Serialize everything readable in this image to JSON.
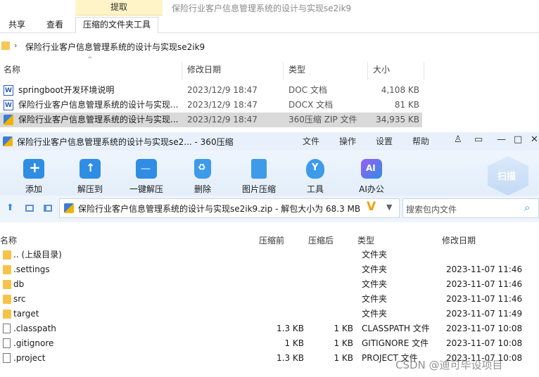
{
  "explorer": {
    "context_tab": "提取",
    "window_title": "保险行业客户信息管理系统的设计与实现se2ik9",
    "ribbon_tabs": [
      "共享",
      "查看",
      "压缩的文件夹工具"
    ],
    "path": "保险行业客户信息管理系统的设计与实现se2ik9",
    "columns": [
      "名称",
      "修改日期",
      "类型",
      "大小"
    ],
    "files": [
      {
        "name": "springboot开发环境说明",
        "date": "2023/12/9 18:47",
        "type": "DOC 文档",
        "size": "4,108 KB",
        "icon": "word-icon"
      },
      {
        "name": "保险行业客户信息管理系统的设计与实现...",
        "date": "2023/12/9 18:47",
        "type": "DOCX 文档",
        "size": "81 KB",
        "icon": "word-icon"
      },
      {
        "name": "保险行业客户信息管理系统的设计与实现...",
        "date": "2023/12/9 18:47",
        "type": "360压缩 ZIP 文件",
        "size": "34,935 KB",
        "icon": "zip-icon",
        "selected": true
      }
    ]
  },
  "zip": {
    "title": "保险行业客户信息管理系统的设计与实现se2... - 360压缩",
    "menu": [
      "文件",
      "操作",
      "设置",
      "帮助"
    ],
    "toolbar": [
      "添加",
      "解压到",
      "一键解压",
      "删除",
      "图片压缩",
      "工具",
      "AI办公"
    ],
    "scan_label": "扫描",
    "path": "保险行业客户信息管理系统的设计与实现se2ik9.zip - 解包大小为 68.3 MB",
    "search_placeholder": "搜索包内文件",
    "columns": [
      "名称",
      "压缩前",
      "压缩后",
      "类型",
      "修改日期"
    ],
    "rows": [
      {
        "name": ".. (上级目录)",
        "before": "",
        "after": "",
        "type": "文件夹",
        "date": "",
        "kind": "folder"
      },
      {
        "name": ".settings",
        "before": "",
        "after": "",
        "type": "文件夹",
        "date": "2023-11-07 11:46",
        "kind": "folder"
      },
      {
        "name": "db",
        "before": "",
        "after": "",
        "type": "文件夹",
        "date": "2023-11-07 11:46",
        "kind": "folder"
      },
      {
        "name": "src",
        "before": "",
        "after": "",
        "type": "文件夹",
        "date": "2023-11-07 11:46",
        "kind": "folder"
      },
      {
        "name": "target",
        "before": "",
        "after": "",
        "type": "文件夹",
        "date": "2023-11-07 11:49",
        "kind": "folder"
      },
      {
        "name": ".classpath",
        "before": "1.3 KB",
        "after": "1 KB",
        "type": "CLASSPATH 文件",
        "date": "2023-11-07 10:08",
        "kind": "file"
      },
      {
        "name": ".gitignore",
        "before": "1 KB",
        "after": "1 KB",
        "type": "GITIGNORE 文件",
        "date": "2023-11-07 10:08",
        "kind": "file"
      },
      {
        "name": ".project",
        "before": "1.3 KB",
        "after": "1 KB",
        "type": "PROJECT 文件",
        "date": "2023-11-07 10:08",
        "kind": "file"
      }
    ]
  },
  "watermark": "CSDN @迪可毕设项目"
}
